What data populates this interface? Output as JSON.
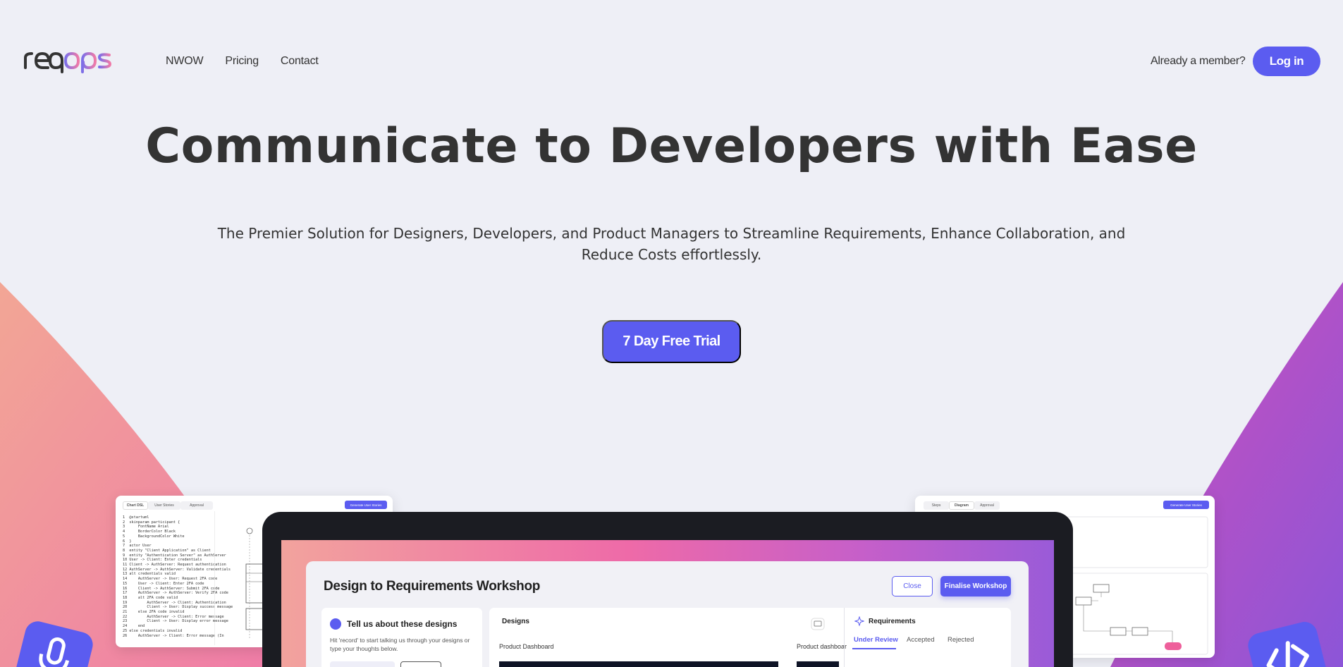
{
  "brand": {
    "logo_text": "reqops",
    "accent": "#5b5cf0"
  },
  "nav": {
    "links": [
      "NWOW",
      "Pricing",
      "Contact"
    ],
    "member_text": "Already a member?",
    "login_label": "Log in"
  },
  "hero": {
    "title": "Communicate to Developers with Ease",
    "subtitle_line1": "The Premier Solution for Designers, Developers, and Product Managers to Streamline Requirements, Enhance Collaboration, and",
    "subtitle_line2": "Reduce Costs effortlessly.",
    "cta_label": "7 Day Free Trial"
  },
  "left_preview": {
    "tabs": [
      "Chart DSL",
      "User Stories",
      "Approval"
    ],
    "button_label": "Generate User Stories",
    "code_lines": [
      "1  @startuml",
      "2  skinparam participant {",
      "3      FontName Arial",
      "4      BorderColor Black",
      "5      BackgroundColor White",
      "6  }",
      "7  actor User",
      "8  entity \"Client Application\" as Client",
      "9  entity \"Authentication Server\" as AuthServer",
      "10 User -> Client: Enter credentials",
      "11 Client -> AuthServer: Request authentication",
      "12 AuthServer -> AuthServer: Validate credentials",
      "13 alt credentials valid",
      "14     AuthServer -> User: Request 2FA code",
      "15     User -> Client: Enter 2FA code",
      "16     Client -> AuthServer: Submit 2FA code",
      "17     AuthServer -> AuthServer: Verify 2FA code",
      "18     alt 2FA code valid",
      "19         AuthServer -> Client: Authentication",
      "20         Client -> User: Display success message",
      "21     else 2FA code invalid",
      "22         AuthServer -> Client: Error message",
      "23         Client -> User: Display error message",
      "24     end",
      "25 else credentials invalid",
      "26     AuthServer -> Client: Error message (In"
    ]
  },
  "right_preview": {
    "tabs": [
      "Steps",
      "Diagram",
      "Approval"
    ],
    "button_label": "Generate User Stories"
  },
  "workshop": {
    "title": "Design to Requirements Workshop",
    "close_label": "Close",
    "finalise_label": "Finalise Workshop",
    "tell_title": "Tell us about these designs",
    "tell_body": "Hit 'record' to start talking us through your designs or type your thoughts below.",
    "designs_title": "Designs",
    "design_items": [
      "Product Dashboard",
      "Product dashboar"
    ],
    "requirements_title": "Requirements",
    "req_tabs": [
      "Under Review",
      "Accepted",
      "Rejected"
    ]
  }
}
